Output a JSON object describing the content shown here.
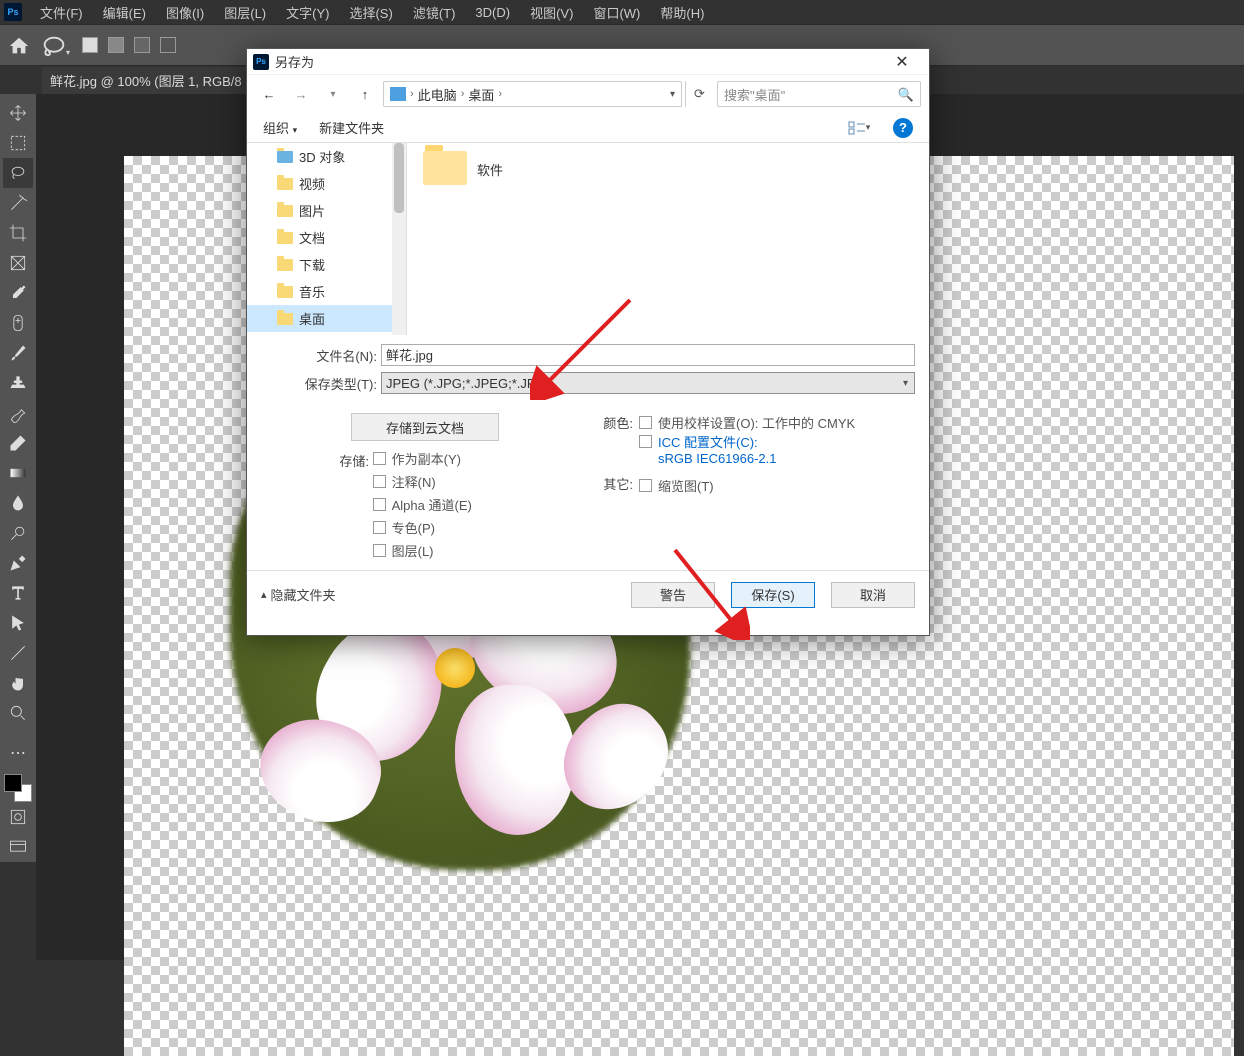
{
  "menu": {
    "items": [
      "文件(F)",
      "编辑(E)",
      "图像(I)",
      "图层(L)",
      "文字(Y)",
      "选择(S)",
      "滤镜(T)",
      "3D(D)",
      "视图(V)",
      "窗口(W)",
      "帮助(H)"
    ]
  },
  "document_tab": "鲜花.jpg @ 100% (图层 1, RGB/8",
  "dialog": {
    "title": "另存为",
    "breadcrumb": {
      "root": "此电脑",
      "folder": "桌面"
    },
    "search_placeholder": "搜索\"桌面\"",
    "organize": "组织",
    "new_folder": "新建文件夹",
    "tree": [
      "3D 对象",
      "视频",
      "图片",
      "文档",
      "下载",
      "音乐",
      "桌面"
    ],
    "tree_selected_index": 6,
    "files": [
      {
        "name": "软件"
      }
    ],
    "filename_label": "文件名(N):",
    "filename_value": "鲜花.jpg",
    "filetype_label": "保存类型(T):",
    "filetype_value": "JPEG (*.JPG;*.JPEG;*.JPE)",
    "cloud_button": "存储到云文档",
    "save_label": "存储:",
    "save_options": [
      "作为副本(Y)",
      "注释(N)",
      "Alpha 通道(E)",
      "专色(P)",
      "图层(L)"
    ],
    "color_label": "颜色:",
    "color_option1": "使用校样设置(O):  工作中的 CMYK",
    "color_option2a": "ICC 配置文件(C):",
    "color_option2b": "sRGB IEC61966-2.1",
    "other_label": "其它:",
    "other_option": "缩览图(T)",
    "hide_folders": "隐藏文件夹",
    "btn_warn": "警告",
    "btn_save": "保存(S)",
    "btn_cancel": "取消"
  }
}
